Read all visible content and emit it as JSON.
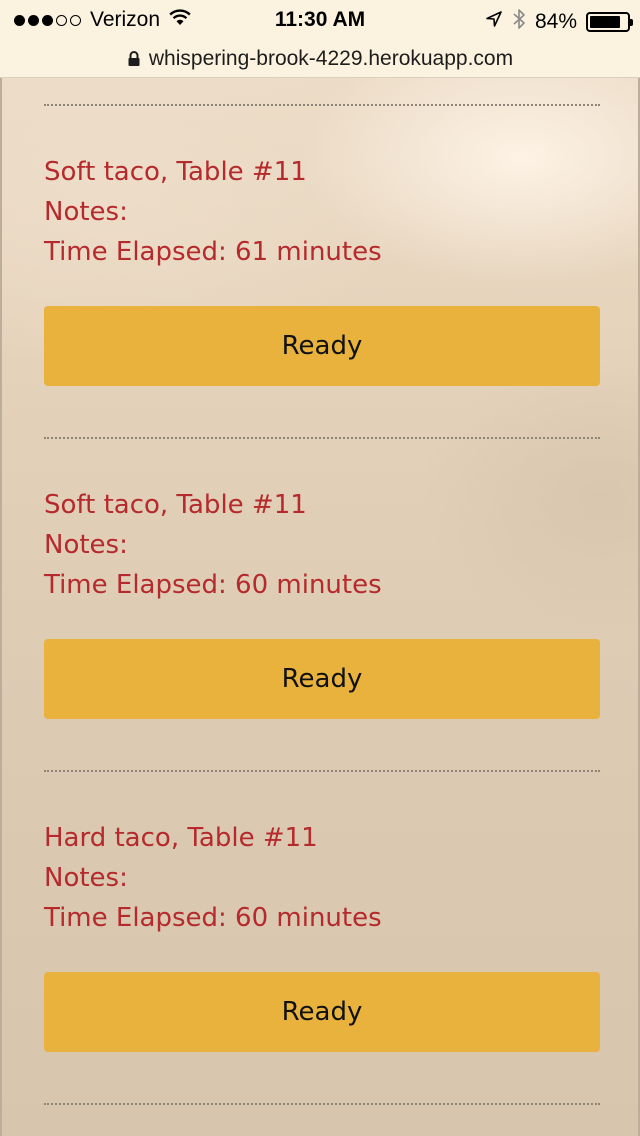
{
  "status_bar": {
    "carrier": "Verizon",
    "time": "11:30 AM",
    "battery": "84%",
    "battery_level": 0.84,
    "signal_bars_filled": 3,
    "signal_bars_total": 5
  },
  "browser": {
    "url": "whispering-brook-4229.herokuapp.com"
  },
  "orders": [
    {
      "title": "Soft taco, Table #11",
      "notes": "Notes:",
      "elapsed": "Time Elapsed: 61 minutes",
      "button": "Ready"
    },
    {
      "title": "Soft taco, Table #11",
      "notes": "Notes:",
      "elapsed": "Time Elapsed: 60 minutes",
      "button": "Ready"
    },
    {
      "title": "Hard taco, Table #11",
      "notes": "Notes:",
      "elapsed": "Time Elapsed: 60 minutes",
      "button": "Ready"
    }
  ],
  "colors": {
    "order_text": "#b52a2c",
    "button_bg": "#e9b23d",
    "browser_chrome": "#fbf3df"
  }
}
